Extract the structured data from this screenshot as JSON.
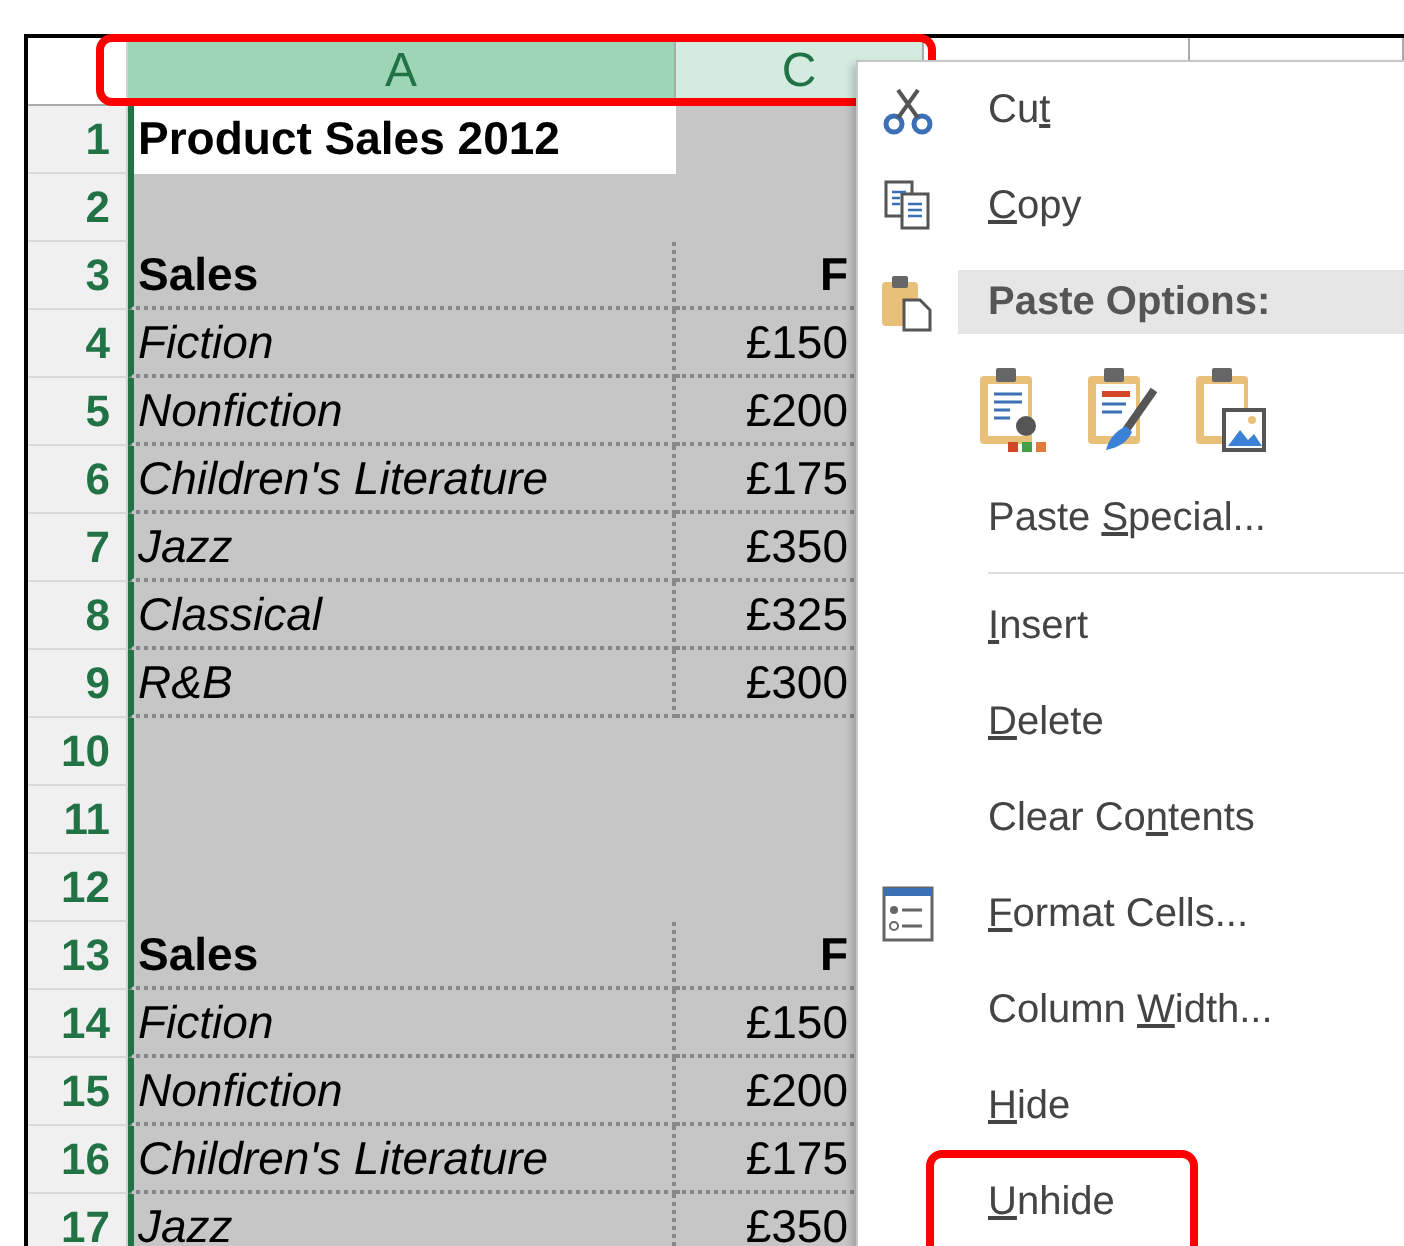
{
  "sheet": {
    "header_outlined": true,
    "column_headers": [
      {
        "label": "A",
        "selected": true,
        "active": true
      },
      {
        "label": "C",
        "selected": true,
        "active": false
      },
      {
        "selected": false,
        "active": false
      },
      {
        "selected": false,
        "active": false
      }
    ],
    "rows": [
      {
        "number": "1",
        "bordered": false,
        "cells": [
          {
            "text": "Product Sales 2012",
            "kind": "title",
            "active": true
          },
          {
            "active": false
          }
        ]
      },
      {
        "number": "2",
        "bordered": false,
        "cells": [
          {
            "active": false
          },
          {
            "active": false
          }
        ]
      },
      {
        "number": "3",
        "bordered": true,
        "cells": [
          {
            "text": "Sales",
            "kind": "heading",
            "active": false
          },
          {
            "text": "F",
            "kind": "heading",
            "active": false
          }
        ]
      },
      {
        "number": "4",
        "bordered": true,
        "cells": [
          {
            "text": "Fiction",
            "kind": "category",
            "active": false
          },
          {
            "text": "£150",
            "kind": "amount",
            "active": false
          }
        ]
      },
      {
        "number": "5",
        "bordered": true,
        "cells": [
          {
            "text": "Nonfiction",
            "kind": "category",
            "active": false
          },
          {
            "text": "£200",
            "kind": "amount",
            "active": false
          }
        ]
      },
      {
        "number": "6",
        "bordered": true,
        "cells": [
          {
            "text": "Children's Literature",
            "kind": "category",
            "active": false
          },
          {
            "text": "£175",
            "kind": "amount",
            "active": false
          }
        ]
      },
      {
        "number": "7",
        "bordered": true,
        "cells": [
          {
            "text": "Jazz",
            "kind": "category",
            "active": false
          },
          {
            "text": "£350",
            "kind": "amount",
            "active": false
          }
        ]
      },
      {
        "number": "8",
        "bordered": true,
        "cells": [
          {
            "text": "Classical",
            "kind": "category",
            "active": false
          },
          {
            "text": "£325",
            "kind": "amount",
            "active": false
          }
        ]
      },
      {
        "number": "9",
        "bordered": true,
        "cells": [
          {
            "text": "R&B",
            "kind": "category",
            "active": false
          },
          {
            "text": "£300",
            "kind": "amount",
            "active": false
          }
        ]
      },
      {
        "number": "10",
        "bordered": false,
        "cells": [
          {
            "active": false
          },
          {
            "active": false
          }
        ]
      },
      {
        "number": "11",
        "bordered": false,
        "cells": [
          {
            "active": false
          },
          {
            "active": false
          }
        ]
      },
      {
        "number": "12",
        "bordered": false,
        "cells": [
          {
            "active": false
          },
          {
            "active": false
          }
        ]
      },
      {
        "number": "13",
        "bordered": true,
        "cells": [
          {
            "text": "Sales",
            "kind": "heading",
            "active": false
          },
          {
            "text": "F",
            "kind": "heading",
            "active": false
          }
        ]
      },
      {
        "number": "14",
        "bordered": true,
        "cells": [
          {
            "text": "Fiction",
            "kind": "category",
            "active": false
          },
          {
            "text": "£150",
            "kind": "amount",
            "active": false
          }
        ]
      },
      {
        "number": "15",
        "bordered": true,
        "cells": [
          {
            "text": "Nonfiction",
            "kind": "category",
            "active": false
          },
          {
            "text": "£200",
            "kind": "amount",
            "active": false
          }
        ]
      },
      {
        "number": "16",
        "bordered": true,
        "cells": [
          {
            "text": "Children's Literature",
            "kind": "category",
            "active": false
          },
          {
            "text": "£175",
            "kind": "amount",
            "active": false
          }
        ]
      },
      {
        "number": "17",
        "bordered": true,
        "cells": [
          {
            "text": "Jazz",
            "kind": "category",
            "active": false
          },
          {
            "text": "£350",
            "kind": "amount",
            "active": false
          }
        ]
      }
    ]
  },
  "context_menu": {
    "items": [
      {
        "kind": "cut",
        "pre": "Cu",
        "key": "t",
        "outlined": false
      },
      {
        "kind": "copy",
        "key": "C",
        "post": "opy",
        "outlined": false
      },
      {
        "kind": "pasteheader",
        "text": "Paste Options:"
      },
      {
        "kind": "pastebuttons"
      },
      {
        "kind": "plain",
        "pre": "Paste ",
        "key": "S",
        "post": "pecial...",
        "outlined": false
      },
      {
        "kind": "separator"
      },
      {
        "kind": "plain",
        "key": "I",
        "post": "nsert",
        "outlined": false
      },
      {
        "kind": "plain",
        "key": "D",
        "post": "elete",
        "outlined": false
      },
      {
        "kind": "plain",
        "pre": "Clear Co",
        "key": "n",
        "post": "tents",
        "outlined": false
      },
      {
        "kind": "format",
        "key": "F",
        "post": "ormat Cells...",
        "outlined": false
      },
      {
        "kind": "plain",
        "pre": "Column ",
        "key": "W",
        "post": "idth...",
        "outlined": false
      },
      {
        "kind": "plain",
        "key": "H",
        "post": "ide",
        "outlined": false
      },
      {
        "kind": "plain",
        "key": "U",
        "post": "nhide",
        "outlined": true
      }
    ]
  }
}
